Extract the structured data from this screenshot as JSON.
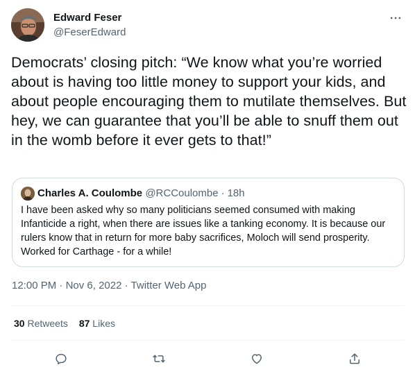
{
  "author": {
    "display_name": "Edward Feser",
    "handle": "@FeserEdward",
    "avatar_icon": "person-photo"
  },
  "tweet": {
    "text": "Democrats’ closing pitch: “We know what you’re worried about is having too little money to support your kids, and about people encouraging them to mutilate themselves. But hey, we can guarantee that you’ll be able to snuff them out in the womb before it ever gets to that!”",
    "time": "12:00 PM",
    "date": "Nov 6, 2022",
    "separator": "·",
    "source": "Twitter Web App"
  },
  "quote": {
    "display_name": "Charles A. Coulombe",
    "handle": "@RCCoulombe",
    "separator": "·",
    "time": "18h",
    "text": "I have been asked why so many politicians seemed consumed with making Infanticide a right, when there are issues like a tanking economy. It is because our rulers know that in return for more baby sacrifices, Moloch will send prosperity. Worked for Carthage - for a while!"
  },
  "stats": {
    "retweets_count": "30",
    "retweets_label": "Retweets",
    "likes_count": "87",
    "likes_label": "Likes"
  },
  "actions": {
    "reply_icon": "reply-icon",
    "retweet_icon": "retweet-icon",
    "like_icon": "like-icon",
    "share_icon": "share-icon"
  },
  "colors": {
    "text_primary": "#0f1419",
    "text_secondary": "#536471",
    "border": "#cfd9de",
    "divider": "#eff3f4"
  }
}
